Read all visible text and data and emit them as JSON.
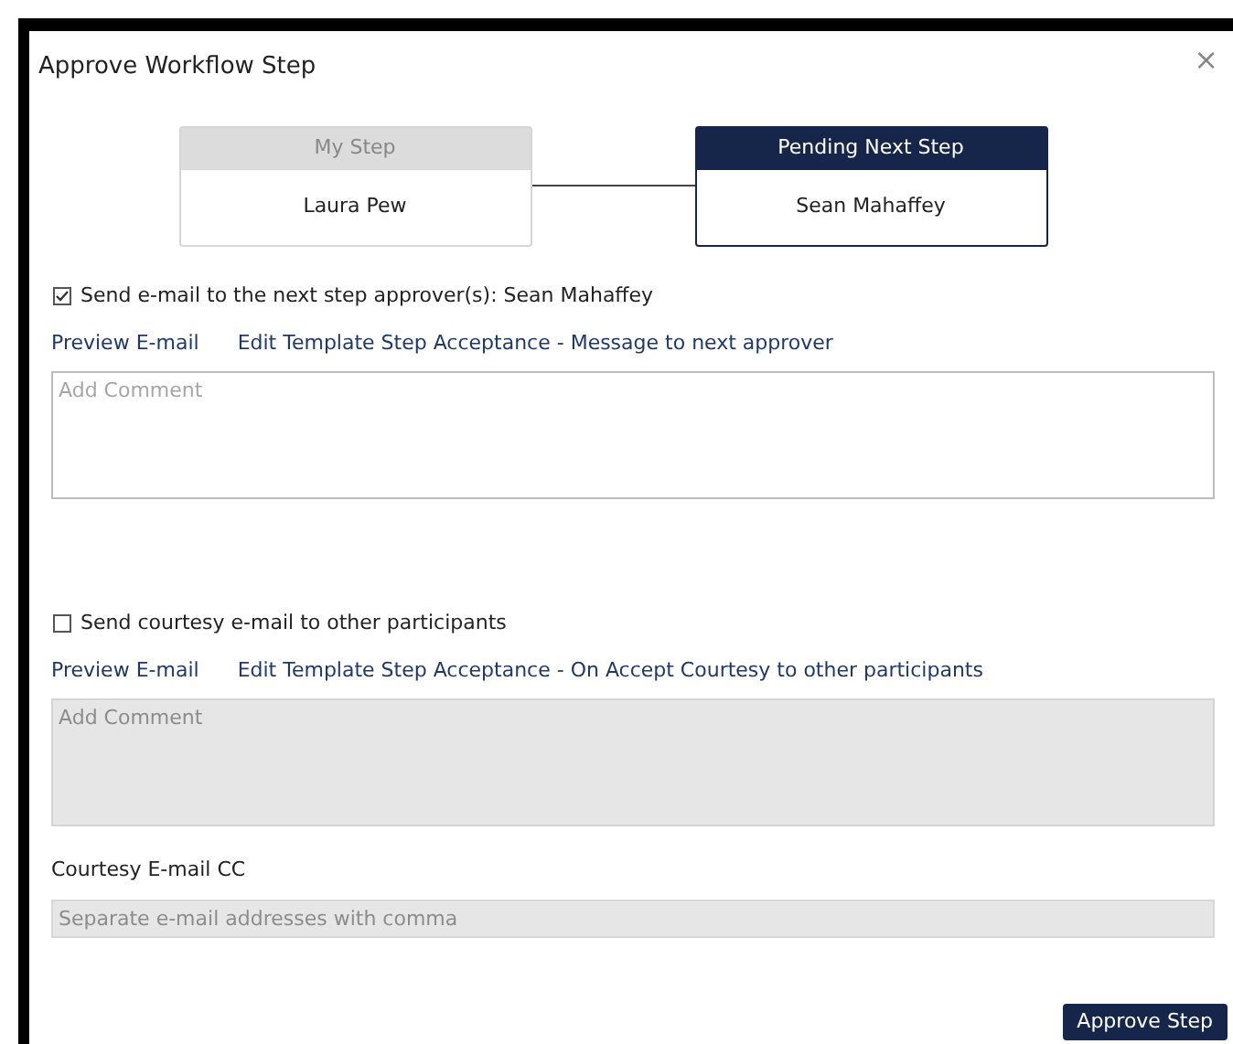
{
  "dialog": {
    "title": "Approve Workflow Step",
    "close": "×"
  },
  "steps": [
    {
      "header": "My Step",
      "name": "Laura Pew",
      "active": false
    },
    {
      "header": "Pending Next Step",
      "name": "Sean Mahaffey",
      "active": true
    }
  ],
  "sections": [
    {
      "label": "Send e-mail to the next step approver(s): Sean Mahaffey",
      "checked": true,
      "links": [
        "Preview E-mail",
        "Edit Template Step Acceptance - Message to next approver"
      ],
      "comment": {
        "placeholder": "Add Comment",
        "disabled": false
      }
    },
    {
      "label": "Send courtesy e-mail to other participants",
      "checked": false,
      "links": [
        "Preview E-mail",
        "Edit Template Step Acceptance - On Accept Courtesy to other participants"
      ],
      "comment": {
        "placeholder": "Add Comment",
        "disabled": true
      }
    }
  ],
  "cc": {
    "label": "Courtesy E-mail CC",
    "placeholder": "Separate e-mail addresses with comma",
    "disabled": true
  },
  "buttons": [
    "Approve Step"
  ]
}
